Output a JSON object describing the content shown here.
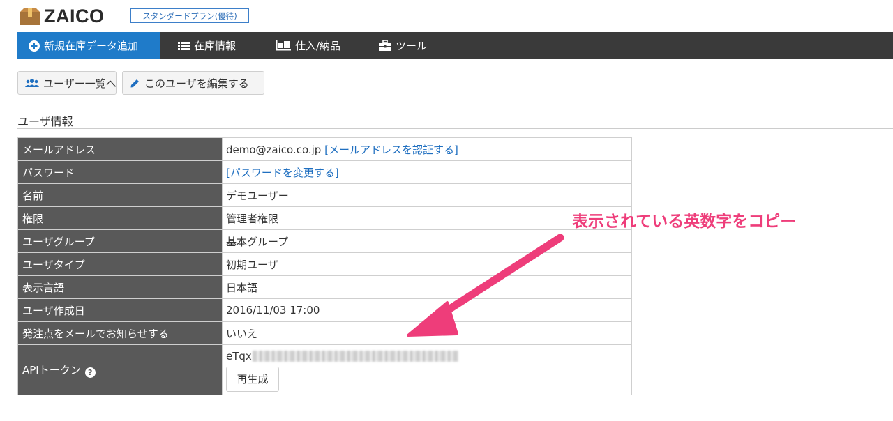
{
  "header": {
    "logo_text": "ZAICO",
    "plan_badge": "スタンダードプラン(優待)"
  },
  "nav": {
    "items": [
      {
        "label": "新規在庫データ追加",
        "icon": "plus-circle-icon",
        "active": true
      },
      {
        "label": "在庫情報",
        "icon": "list-icon",
        "active": false
      },
      {
        "label": "仕入/納品",
        "icon": "dolly-icon",
        "active": false
      },
      {
        "label": "ツール",
        "icon": "toolbox-icon",
        "active": false
      }
    ]
  },
  "actions": {
    "user_list_label": "ユーザー一覧へ",
    "edit_user_label": "このユーザを編集する"
  },
  "section": {
    "title": "ユーザ情報"
  },
  "user_info": {
    "rows": [
      {
        "label": "メールアドレス",
        "value": "demo@zaico.co.jp",
        "link": "[メールアドレスを認証する]"
      },
      {
        "label": "パスワード",
        "value": "",
        "link": "[パスワードを変更する]"
      },
      {
        "label": "名前",
        "value": "デモユーザー"
      },
      {
        "label": "権限",
        "value": "管理者権限"
      },
      {
        "label": "ユーザグループ",
        "value": "基本グループ"
      },
      {
        "label": "ユーザタイプ",
        "value": "初期ユーザ"
      },
      {
        "label": "表示言語",
        "value": "日本語"
      },
      {
        "label": "ユーザ作成日",
        "value": "2016/11/03 17:00"
      },
      {
        "label": "発注点をメールでお知らせする",
        "value": "いいえ"
      }
    ],
    "api": {
      "label": "APIトークン",
      "token_visible": "eTqx",
      "regenerate_label": "再生成"
    }
  },
  "annotation": {
    "text": "表示されている英数字をコピー",
    "color": "#ee3d7a"
  },
  "colors": {
    "nav_bg": "#3a3a3a",
    "nav_active": "#1f7bc9",
    "label_bg": "#595959",
    "link": "#1f6fc0"
  }
}
